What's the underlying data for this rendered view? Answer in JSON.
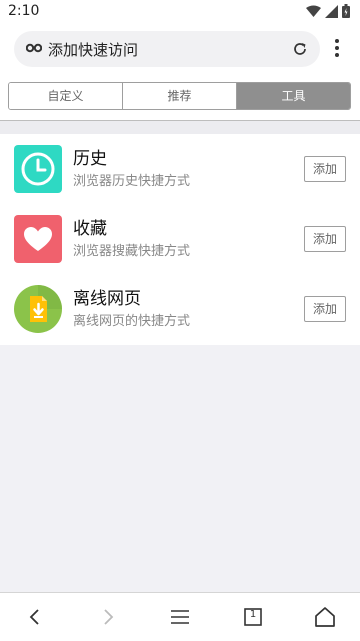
{
  "status": {
    "time": "2:10"
  },
  "address": {
    "title": "添加快速访问"
  },
  "tabs": [
    {
      "label": "自定义",
      "active": false
    },
    {
      "label": "推荐",
      "active": false
    },
    {
      "label": "工具",
      "active": true
    }
  ],
  "items": [
    {
      "title": "历史",
      "subtitle": "浏览器历史快捷方式",
      "button": "添加",
      "icon": "clock-icon",
      "color": "#2ed9c3"
    },
    {
      "title": "收藏",
      "subtitle": "浏览器搜藏快捷方式",
      "button": "添加",
      "icon": "heart-icon",
      "color": "#f0616d"
    },
    {
      "title": "离线网页",
      "subtitle": "离线网页的快捷方式",
      "button": "添加",
      "icon": "offline-page-icon",
      "color": "#8bc34a"
    }
  ],
  "nav": {
    "page_count": "1",
    "icons": [
      "back-icon",
      "forward-icon",
      "menu-lines-icon",
      "tabs-icon",
      "home-icon"
    ]
  }
}
